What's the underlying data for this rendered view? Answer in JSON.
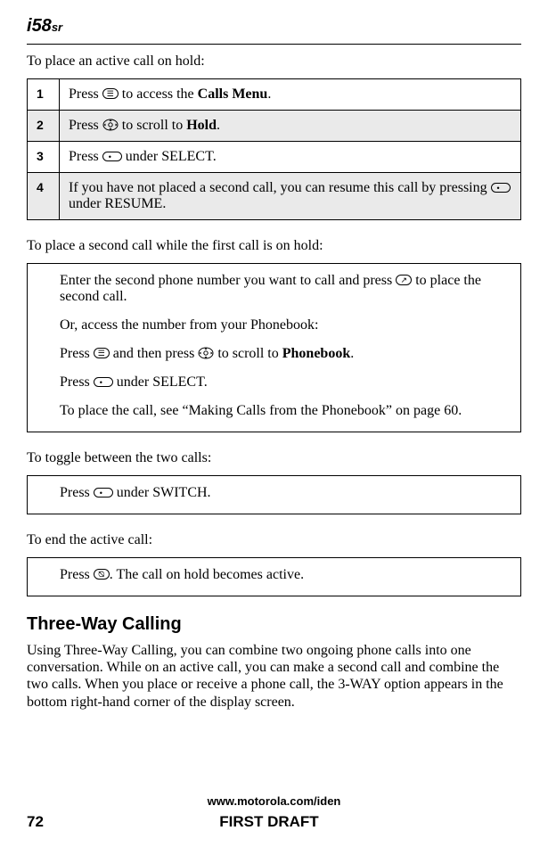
{
  "logo": {
    "prefix": "i",
    "model": "58",
    "suffix": "sr"
  },
  "intro1": "To place an active call on hold:",
  "steps": [
    {
      "num": "1",
      "pre": "Press ",
      "post": " to access the ",
      "bold": "Calls Menu",
      "end": ".",
      "shaded": false,
      "icon": "menu"
    },
    {
      "num": "2",
      "pre": "Press ",
      "post": " to scroll to ",
      "bold": "Hold",
      "end": ".",
      "shaded": true,
      "icon": "nav"
    },
    {
      "num": "3",
      "pre": "Press ",
      "post": " under SELECT.",
      "shaded": false,
      "icon": "softkey"
    },
    {
      "num": "4",
      "pre": "If you have not placed a second call, you can resume this call by pressing ",
      "post": " under RESUME.",
      "shaded": true,
      "icon": "softkey"
    }
  ],
  "intro2": "To place a second call while the first call is on hold:",
  "box2": {
    "p1a": "Enter the second phone number you want to call and press ",
    "p1b": " to place the second call.",
    "p2": "Or, access the number from your Phonebook:",
    "p3a": "Press ",
    "p3b": " and then press ",
    "p3c": " to scroll to ",
    "p3bold": "Phonebook",
    "p3d": ".",
    "p4a": "Press ",
    "p4b": " under SELECT.",
    "p5": "To place the call, see “Making Calls from the Phonebook” on page 60."
  },
  "intro3": "To toggle between the two calls:",
  "box3": {
    "a": "Press ",
    "b": " under SWITCH."
  },
  "intro4": "To end the active call:",
  "box4": {
    "a": "Press ",
    "b": ". The call on hold becomes active."
  },
  "heading": "Three-Way Calling",
  "para": "Using Three-Way Calling, you can combine two ongoing phone calls into one conversation. While on an active call, you can make a second call and combine the two calls. When you place or receive a phone call, the 3-WAY option appears in the bottom right-hand corner of the display screen.",
  "footer": {
    "url": "www.motorola.com/iden",
    "page": "72",
    "draft": "FIRST DRAFT"
  }
}
